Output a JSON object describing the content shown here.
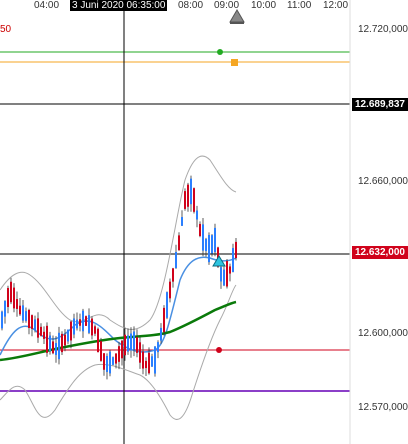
{
  "time_axis": {
    "labels": [
      "04:00",
      "08:00",
      "09:00",
      "10:00",
      "11:00",
      "12:00"
    ],
    "cursor_label": "3 Juni 2020 06:35:00"
  },
  "price_axis": {
    "labels": [
      "12.720,000",
      "12.660,000",
      "12.600,000",
      "12.570,000"
    ],
    "cursor_price": "12.689,837",
    "last_price": "12.632,000"
  },
  "corner_label": "50",
  "colors": {
    "bull": "#2a7fff",
    "bear": "#d0021b",
    "ma_long": "#0a7a0a",
    "ma_short": "#4a90e2",
    "band": "#aaaaaa",
    "green_line": "#22aa22",
    "orange_line": "#f5a623",
    "red_line": "#d0021b",
    "purple_line": "#8b3fc8",
    "cursor": "#000000",
    "last_price_tag": "#d0021b",
    "cursor_price_tag": "#000000"
  },
  "icons": {
    "top_marker": "bell-icon",
    "buy_marker": "triangle-up-icon",
    "alert_marker": "square-icon"
  }
}
